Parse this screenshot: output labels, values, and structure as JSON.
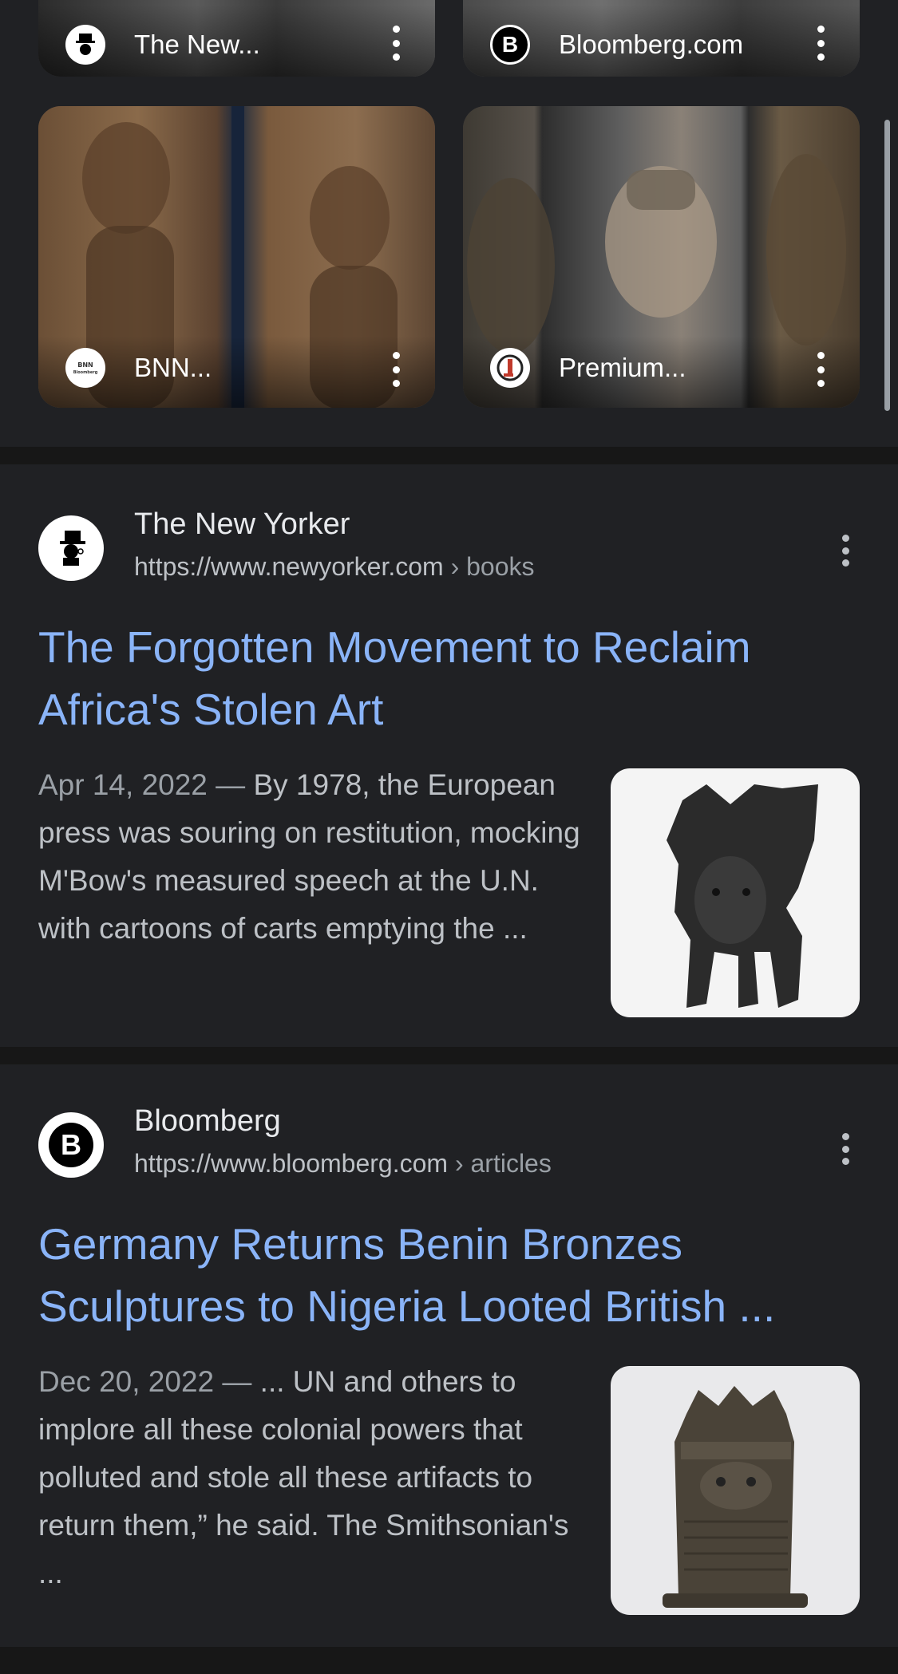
{
  "image_results": [
    {
      "source": "The New...",
      "favicon": "newyorker-favicon-icon"
    },
    {
      "source": "Bloomberg.com",
      "favicon": "bloomberg-favicon-icon"
    },
    {
      "source": "BNN...",
      "favicon": "bnn-favicon-icon"
    },
    {
      "source": "Premium...",
      "favicon": "premium-times-favicon-icon"
    }
  ],
  "results": [
    {
      "site_name": "The New Yorker",
      "url": "https://www.newyorker.com",
      "crumb": " › books",
      "title": "The Forgotten Movement to Reclaim\nAfrica's Stolen Art",
      "date": "Apr 14, 2022",
      "date_sep": " — ",
      "snippet": "By 1978, the European press was souring on restitution, mocking M'Bow's measured speech at the U.N. with cartoons of carts emptying the ..."
    },
    {
      "site_name": "Bloomberg",
      "url": "https://www.bloomberg.com",
      "crumb": " › articles",
      "title": "Germany Returns Benin Bronzes\nSculptures to Nigeria Looted British ...",
      "date": "Dec 20, 2022",
      "date_sep": " — ",
      "snippet": "... UN and others to implore all these colonial powers that polluted and stole all these artifacts to return them,” he said. The Smithsonian's ..."
    }
  ],
  "colors": {
    "background": "#202124",
    "link": "#8ab4f8",
    "text": "#bdc1c6"
  },
  "favicon_letters": {
    "bloomberg": "B"
  }
}
